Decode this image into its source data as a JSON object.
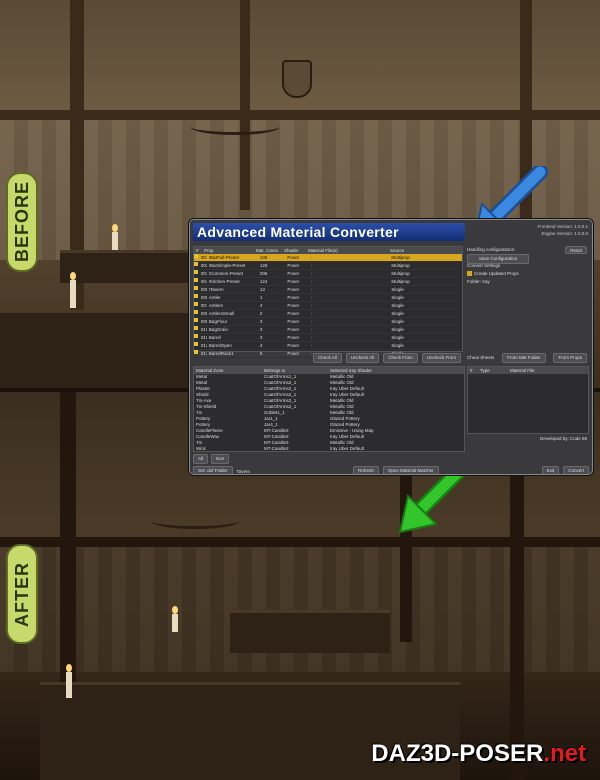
{
  "labels": {
    "before": "BEFORE",
    "after": "AFTER"
  },
  "watermark": {
    "main": "DAZ3D-POSER",
    "suffix": ".net"
  },
  "colors": {
    "pill": "#c7d96b",
    "arrow_blue": "#3a88e0",
    "arrow_green": "#33c62b",
    "selection": "#d7a720"
  },
  "dialog": {
    "title": "Advanced Material Converter",
    "frontend_version": "Frontend Version: 1.0.0.1",
    "engine_version": "Engine Version: 1.0.0.0",
    "grid_headers": [
      "#",
      "Prop",
      "Mat. zones",
      "Shader",
      "Material File(s)",
      "Source"
    ],
    "grid_rows": [
      [
        "001",
        "!BarFull-Preset",
        "136",
        "Poser",
        "-",
        "Multiprop"
      ],
      [
        "002",
        "!BarSimple-Preset",
        "126",
        "Poser",
        "-",
        "Multiprop"
      ],
      [
        "003",
        "!Common-Preset",
        "206",
        "Poser",
        "-",
        "Multiprop"
      ],
      [
        "004",
        "!Kitchen-Preset",
        "124",
        "Poser",
        "-",
        "Multiprop"
      ],
      [
        "005",
        "!Tavern",
        "13",
        "Poser",
        "-",
        "Single"
      ],
      [
        "006",
        "Antler",
        "1",
        "Poser",
        "-",
        "Single"
      ],
      [
        "007",
        "Antlers",
        "4",
        "Poser",
        "-",
        "Single"
      ],
      [
        "008",
        "AntlersSmall",
        "2",
        "Poser",
        "-",
        "Single"
      ],
      [
        "009",
        "BagFlour",
        "3",
        "Poser",
        "-",
        "Single"
      ],
      [
        "010",
        "BagGrain",
        "3",
        "Poser",
        "-",
        "Single"
      ],
      [
        "011",
        "Barrel",
        "3",
        "Poser",
        "-",
        "Single"
      ],
      [
        "012",
        "BarrelOpen",
        "4",
        "Poser",
        "-",
        "Single"
      ],
      [
        "013",
        "BarrelRack1",
        "5",
        "Poser",
        "-",
        "Single"
      ]
    ],
    "grid_buttons": [
      "Check All",
      "Uncheck All",
      "Check From",
      "Uncheck From"
    ],
    "right": {
      "handling_label": "Handling configurations:",
      "reset": "Reset",
      "save_config": "Save Configuration",
      "convert_label": "Convert Settings",
      "create_updated": "Create Updated Props",
      "folder_label": "Folder:",
      "folder_value": "Iray"
    },
    "zone_headers": [
      "Material Zone",
      "Belongs to",
      "Selected Iray Shader"
    ],
    "zone_rows": [
      [
        "Metal",
        "CoatOfArms1_1",
        "Metallic Old"
      ],
      [
        "Metal",
        "CoatOfArms2_1",
        "Metallic Old"
      ],
      [
        "Plaster",
        "CoatOfArms2_1",
        "Iray Uber Default"
      ],
      [
        "Shield",
        "CoatOfArms2_1",
        "Iray Uber Default"
      ],
      [
        "Tin-Axe",
        "CoatOfArms2_1",
        "Metallic Old"
      ],
      [
        "Tin-Shield",
        "CoatOfArms2_1",
        "Metallic Old"
      ],
      [
        "Tin",
        "Goblet1_1",
        "Metallic Old"
      ],
      [
        "Pottery",
        "Jar1_1",
        "Glazed Pottery"
      ],
      [
        "Pottery",
        "Jar4_1",
        "Glazed Pottery"
      ],
      [
        "CandleFlame",
        "MT-Candle3",
        "Emissive - Using Map"
      ],
      [
        "CandleWax",
        "MT-Candle3",
        "Iray Uber Default"
      ],
      [
        "Tin",
        "MT-Candle3",
        "Metallic Old"
      ],
      [
        "Wick",
        "MT-Candle3",
        "Iray Uber Default"
      ]
    ],
    "sheet_buttons": [
      "Cheat Sheets",
      "From Mat Folder",
      "From Props"
    ],
    "mat_headers": [
      "#",
      "Type",
      "Material File"
    ],
    "developed_by": "Developed by: Code 66",
    "all": "All",
    "non": "Non",
    "set_folder": "Set .duf Folder",
    "folder_name": "Tavern",
    "refresh": "Refresh",
    "open_matcher": "Open Material Matcher",
    "exit": "Exit",
    "convert": "Convert"
  }
}
